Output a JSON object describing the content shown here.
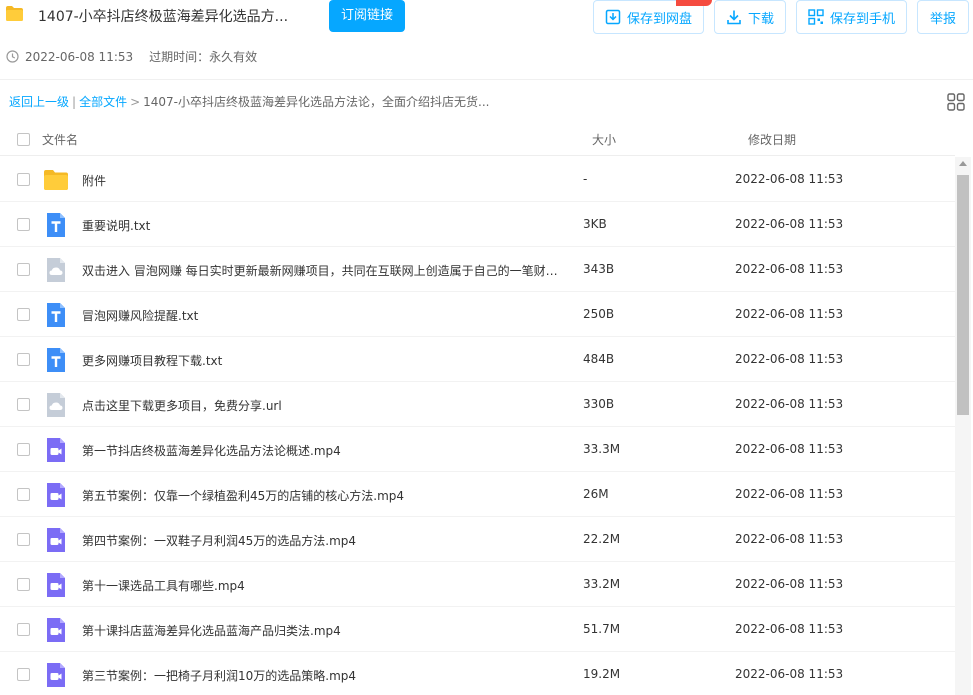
{
  "header": {
    "title": "1407-小卒抖店终极蓝海差异化选品方...",
    "subscribe_label": "订阅链接",
    "save_disk_label": "保存到网盘",
    "download_label": "下载",
    "save_phone_label": "保存到手机",
    "report_label": "举报",
    "accent_color": "#06a7ff"
  },
  "meta": {
    "share_time": "2022-06-08 11:53",
    "expire_text": "过期时间：永久有效"
  },
  "breadcrumb": {
    "back_label": "返回上一级",
    "all_files_label": "全部文件",
    "current": "1407-小卒抖店终极蓝海差异化选品方法论，全面介绍抖店无货..."
  },
  "table": {
    "headers": {
      "name": "文件名",
      "size": "大小",
      "date": "修改日期"
    },
    "rows": [
      {
        "icon": "folder-icon",
        "name": "附件",
        "size": "-",
        "date": "2022-06-08 11:53"
      },
      {
        "icon": "txt-file-icon",
        "name": "重要说明.txt",
        "size": "3KB",
        "date": "2022-06-08 11:53"
      },
      {
        "icon": "cloud-file-icon",
        "name": "双击进入 冒泡网赚 每日实时更新最新网赚项目，共同在互联网上创造属于自己的一笔财富.url",
        "size": "343B",
        "date": "2022-06-08 11:53"
      },
      {
        "icon": "txt-file-icon",
        "name": "冒泡网赚风险提醒.txt",
        "size": "250B",
        "date": "2022-06-08 11:53"
      },
      {
        "icon": "txt-file-icon",
        "name": "更多网赚项目教程下载.txt",
        "size": "484B",
        "date": "2022-06-08 11:53"
      },
      {
        "icon": "cloud-file-icon",
        "name": "点击这里下载更多项目，免费分享.url",
        "size": "330B",
        "date": "2022-06-08 11:53"
      },
      {
        "icon": "video-file-icon",
        "name": "第一节抖店终极蓝海差异化选品方法论概述.mp4",
        "size": "33.3M",
        "date": "2022-06-08 11:53"
      },
      {
        "icon": "video-file-icon",
        "name": "第五节案例：仅靠一个绿植盈利45万的店铺的核心方法.mp4",
        "size": "26M",
        "date": "2022-06-08 11:53"
      },
      {
        "icon": "video-file-icon",
        "name": "第四节案例：一双鞋子月利润45万的选品方法.mp4",
        "size": "22.2M",
        "date": "2022-06-08 11:53"
      },
      {
        "icon": "video-file-icon",
        "name": "第十一课选品工具有哪些.mp4",
        "size": "33.2M",
        "date": "2022-06-08 11:53"
      },
      {
        "icon": "video-file-icon",
        "name": "第十课抖店蓝海差异化选品蓝海产品归类法.mp4",
        "size": "51.7M",
        "date": "2022-06-08 11:53"
      },
      {
        "icon": "video-file-icon",
        "name": "第三节案例：一把椅子月利润10万的选品策略.mp4",
        "size": "19.2M",
        "date": "2022-06-08 11:53"
      }
    ]
  }
}
